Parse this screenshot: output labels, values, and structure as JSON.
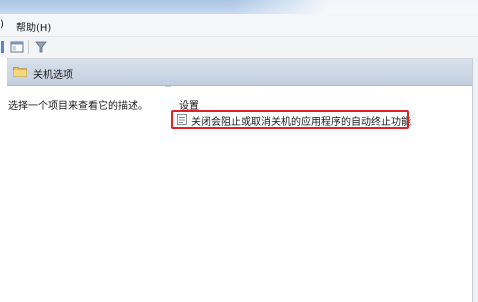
{
  "menubar": {
    "left_fragment": ")",
    "help_label": "帮助(H)"
  },
  "toolbar": {
    "icons": [
      "show-hide-pane-icon",
      "filter-icon"
    ]
  },
  "header": {
    "folder_icon": "folder-icon",
    "title": "关机选项"
  },
  "description": {
    "text": "选择一个项目来查看它的描述。"
  },
  "list": {
    "column_header": "设置",
    "items": [
      {
        "icon": "policy-setting-icon",
        "label": "关闭会阻止或取消关机的应用程序的自动终止功能",
        "highlighted": true
      }
    ]
  },
  "colors": {
    "highlight_border": "#e0202a",
    "header_bg": "#c8d4e3"
  }
}
